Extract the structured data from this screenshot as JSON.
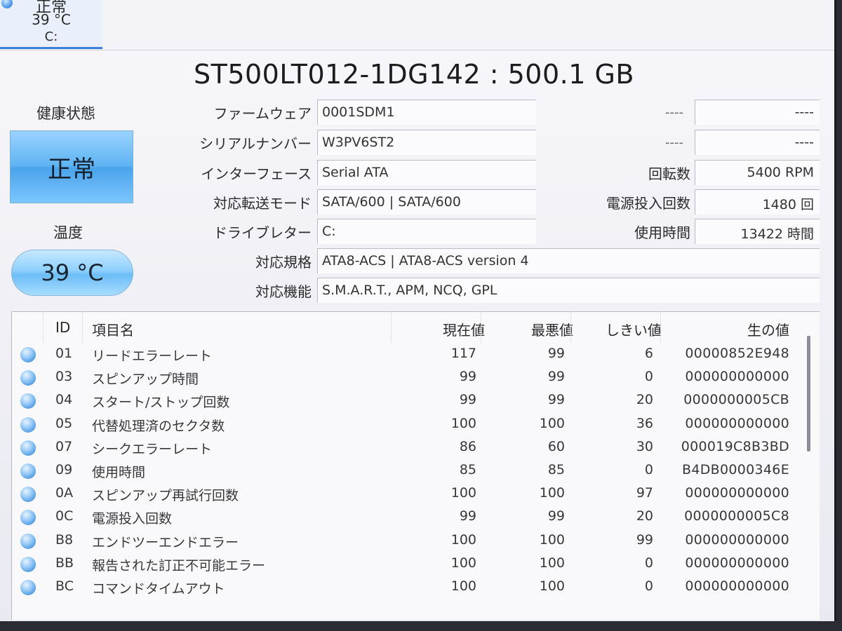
{
  "disk_tab": {
    "status": "正常",
    "temp": "39 °C",
    "drive": "C:"
  },
  "title": "ST500LT012-1DG142 : 500.1 GB",
  "health": {
    "label": "健康状態",
    "value": "正常"
  },
  "temperature": {
    "label": "温度",
    "value": "39 °C"
  },
  "info": {
    "firmware": {
      "label": "ファームウェア",
      "value": "0001SDM1"
    },
    "serial": {
      "label": "シリアルナンバー",
      "value": "W3PV6ST2"
    },
    "interface": {
      "label": "インターフェース",
      "value": "Serial ATA"
    },
    "transfer": {
      "label": "対応転送モード",
      "value": "SATA/600 | SATA/600"
    },
    "drive_letter": {
      "label": "ドライブレター",
      "value": "C:"
    },
    "standard": {
      "label": "対応規格",
      "value": "ATA8-ACS | ATA8-ACS version 4"
    },
    "features": {
      "label": "対応機能",
      "value": "S.M.A.R.T., APM, NCQ, GPL"
    }
  },
  "right_info": {
    "r1": {
      "label": "----",
      "value": "----"
    },
    "r2": {
      "label": "----",
      "value": "----"
    },
    "rotation": {
      "label": "回転数",
      "value": "5400 RPM"
    },
    "power_count": {
      "label": "電源投入回数",
      "value": "1480 回"
    },
    "power_hours": {
      "label": "使用時間",
      "value": "13422 時間"
    }
  },
  "table": {
    "headers": {
      "id": "ID",
      "name": "項目名",
      "current": "現在値",
      "worst": "最悪値",
      "threshold": "しきい値",
      "raw": "生の値"
    },
    "rows": [
      {
        "id": "01",
        "name": "リードエラーレート",
        "current": "117",
        "worst": "99",
        "threshold": "6",
        "raw": "00000852E948"
      },
      {
        "id": "03",
        "name": "スピンアップ時間",
        "current": "99",
        "worst": "99",
        "threshold": "0",
        "raw": "000000000000"
      },
      {
        "id": "04",
        "name": "スタート/ストップ回数",
        "current": "99",
        "worst": "99",
        "threshold": "20",
        "raw": "0000000005CB"
      },
      {
        "id": "05",
        "name": "代替処理済のセクタ数",
        "current": "100",
        "worst": "100",
        "threshold": "36",
        "raw": "000000000000"
      },
      {
        "id": "07",
        "name": "シークエラーレート",
        "current": "86",
        "worst": "60",
        "threshold": "30",
        "raw": "000019C8B3BD"
      },
      {
        "id": "09",
        "name": "使用時間",
        "current": "85",
        "worst": "85",
        "threshold": "0",
        "raw": "B4DB0000346E"
      },
      {
        "id": "0A",
        "name": "スピンアップ再試行回数",
        "current": "100",
        "worst": "100",
        "threshold": "97",
        "raw": "000000000000"
      },
      {
        "id": "0C",
        "name": "電源投入回数",
        "current": "99",
        "worst": "99",
        "threshold": "20",
        "raw": "0000000005C8"
      },
      {
        "id": "B8",
        "name": "エンドツーエンドエラー",
        "current": "100",
        "worst": "100",
        "threshold": "99",
        "raw": "000000000000"
      },
      {
        "id": "BB",
        "name": "報告された訂正不可能エラー",
        "current": "100",
        "worst": "100",
        "threshold": "0",
        "raw": "000000000000"
      },
      {
        "id": "BC",
        "name": "コマンドタイムアウト",
        "current": "100",
        "worst": "100",
        "threshold": "0",
        "raw": "000000000000"
      }
    ]
  }
}
